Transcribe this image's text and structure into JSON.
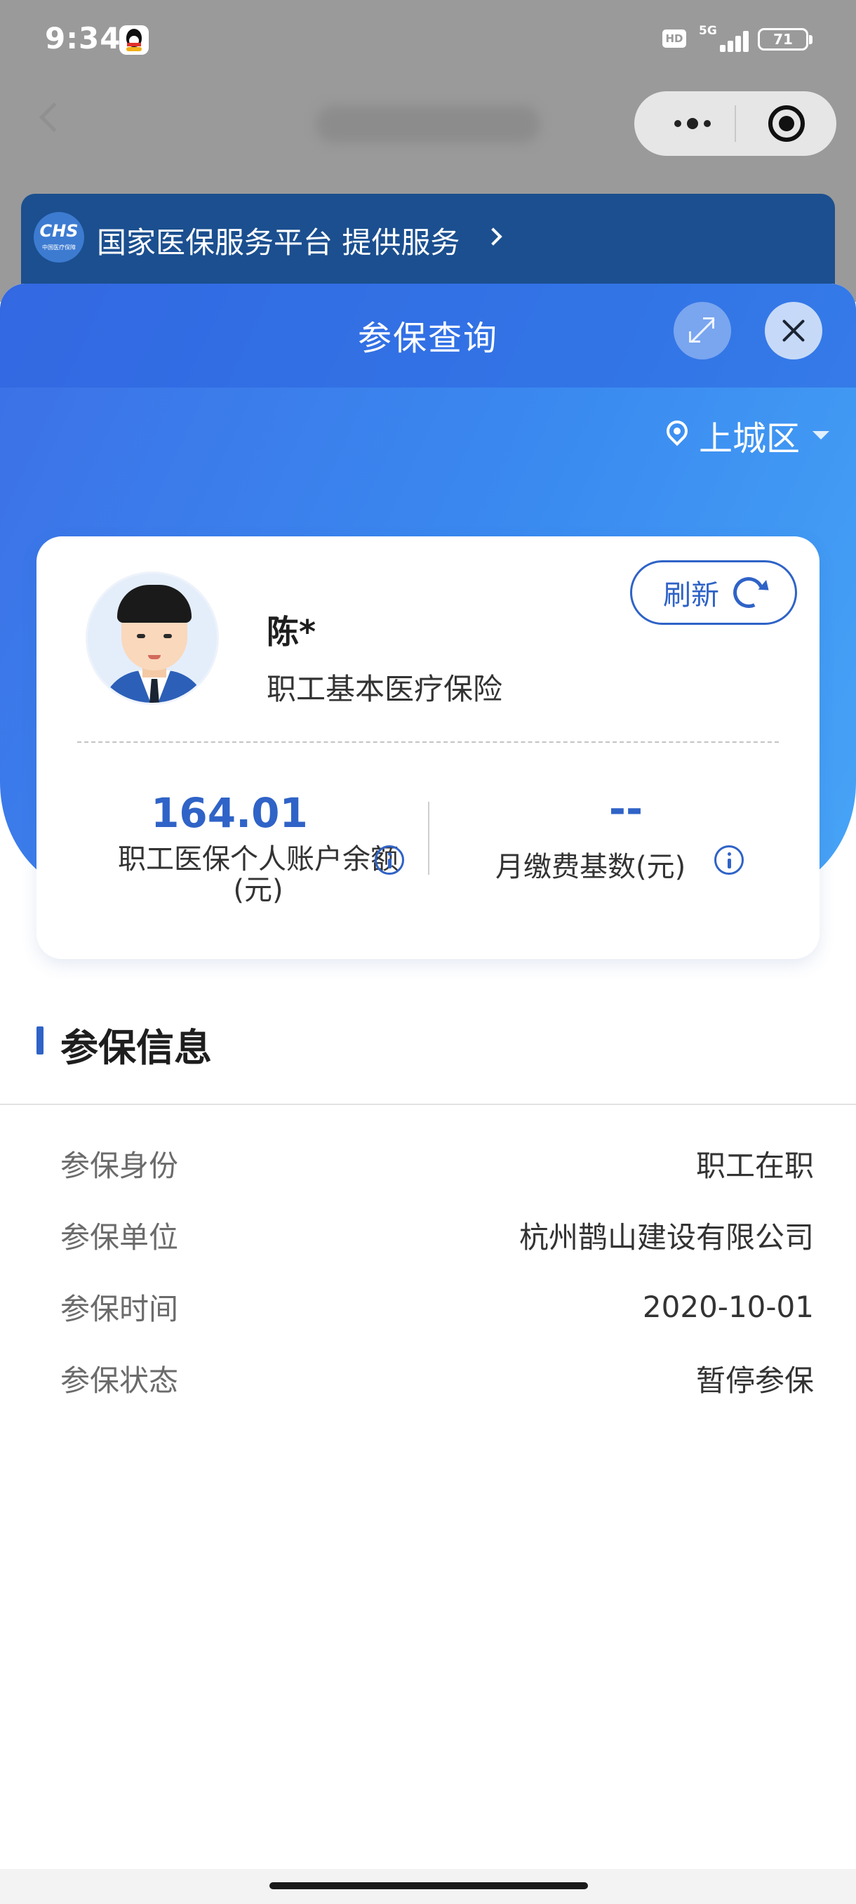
{
  "status_bar": {
    "time": "9:34",
    "hd": "HD",
    "network": "5G",
    "battery": "71"
  },
  "background_page": {
    "banner_logo": "CHS",
    "banner_logo_sub": "中国医疗保障",
    "banner_text": "国家医保服务平台 提供服务"
  },
  "modal": {
    "title": "参保查询",
    "location": "上城区"
  },
  "profile": {
    "name": "陈*",
    "insurance_type": "职工基本医疗保险",
    "refresh_label": "刷新"
  },
  "stats": {
    "account_balance_value": "164.01",
    "account_balance_label": "职工医保个人账户余额(元)",
    "monthly_base_value": "--",
    "monthly_base_label": "月缴费基数(元)"
  },
  "insurance_info": {
    "title": "参保信息",
    "rows": [
      {
        "label": "参保身份",
        "value": "职工在职"
      },
      {
        "label": "参保单位",
        "value": "杭州鹊山建设有限公司"
      },
      {
        "label": "参保时间",
        "value": "2020-10-01"
      },
      {
        "label": "参保状态",
        "value": "暂停参保"
      }
    ]
  },
  "colors": {
    "accent": "#2f63c7",
    "hero_gradient_start": "#3c70e6",
    "hero_gradient_end": "#47a4f6"
  }
}
